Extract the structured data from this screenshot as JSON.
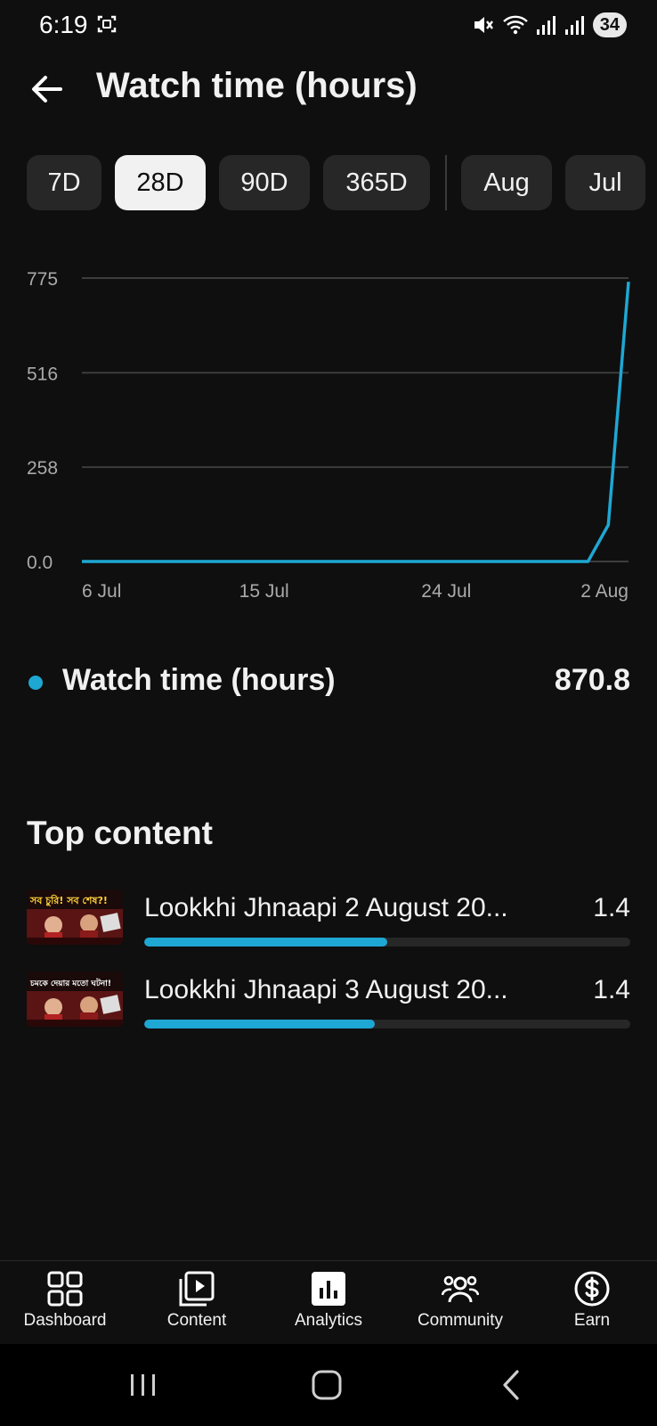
{
  "status_bar": {
    "time": "6:19",
    "battery": "34"
  },
  "header": {
    "title": "Watch time (hours)"
  },
  "chips": [
    {
      "label": "7D",
      "selected": false
    },
    {
      "label": "28D",
      "selected": true
    },
    {
      "label": "90D",
      "selected": false
    },
    {
      "label": "365D",
      "selected": false
    },
    {
      "label": "Aug",
      "selected": false
    },
    {
      "label": "Jul",
      "selected": false
    }
  ],
  "chart_data": {
    "type": "line",
    "title": "",
    "xlabel": "",
    "ylabel": "",
    "x_ticks": [
      "6 Jul",
      "15 Jul",
      "24 Jul",
      "2 Aug"
    ],
    "y_ticks": [
      "0.0",
      "258",
      "516",
      "775"
    ],
    "ylim": [
      0,
      775
    ],
    "xlim": [
      "2025-07-06",
      "2025-08-02"
    ],
    "grid": true,
    "color": "#1ea7d3",
    "series": [
      {
        "x": [
          "2025-07-06",
          "2025-07-07",
          "2025-07-08",
          "2025-07-09",
          "2025-07-10",
          "2025-07-11",
          "2025-07-12",
          "2025-07-13",
          "2025-07-14",
          "2025-07-15",
          "2025-07-16",
          "2025-07-17",
          "2025-07-18",
          "2025-07-19",
          "2025-07-20",
          "2025-07-21",
          "2025-07-22",
          "2025-07-23",
          "2025-07-24",
          "2025-07-25",
          "2025-07-26",
          "2025-07-27",
          "2025-07-28",
          "2025-07-29",
          "2025-07-30",
          "2025-07-31",
          "2025-08-01",
          "2025-08-02"
        ],
        "values": [
          0,
          0,
          0,
          0,
          0,
          0,
          0,
          0,
          0,
          0,
          0,
          0,
          0,
          0,
          0,
          0,
          0,
          0,
          0,
          0,
          0,
          0,
          0,
          0,
          0,
          0,
          100,
          765
        ]
      }
    ]
  },
  "legend": {
    "label": "Watch time (hours)",
    "value": "870.8"
  },
  "top_content": {
    "title": "Top content",
    "items": [
      {
        "title": "Lookkhi Jhnaapi 2 August 20...",
        "value": "1.4",
        "share": 0.5,
        "thumb_text": "সব চুরি! সব শেষ?!"
      },
      {
        "title": "Lookkhi Jhnaapi 3 August 20...",
        "value": "1.4",
        "share": 0.475,
        "thumb_text": "চমকে দেয়ার মতো ঘটনা!"
      }
    ]
  },
  "bottom_nav": [
    {
      "label": "Dashboard",
      "icon": "dashboard-icon"
    },
    {
      "label": "Content",
      "icon": "content-icon"
    },
    {
      "label": "Analytics",
      "icon": "analytics-icon",
      "active": true
    },
    {
      "label": "Community",
      "icon": "community-icon"
    },
    {
      "label": "Earn",
      "icon": "earn-icon"
    }
  ]
}
